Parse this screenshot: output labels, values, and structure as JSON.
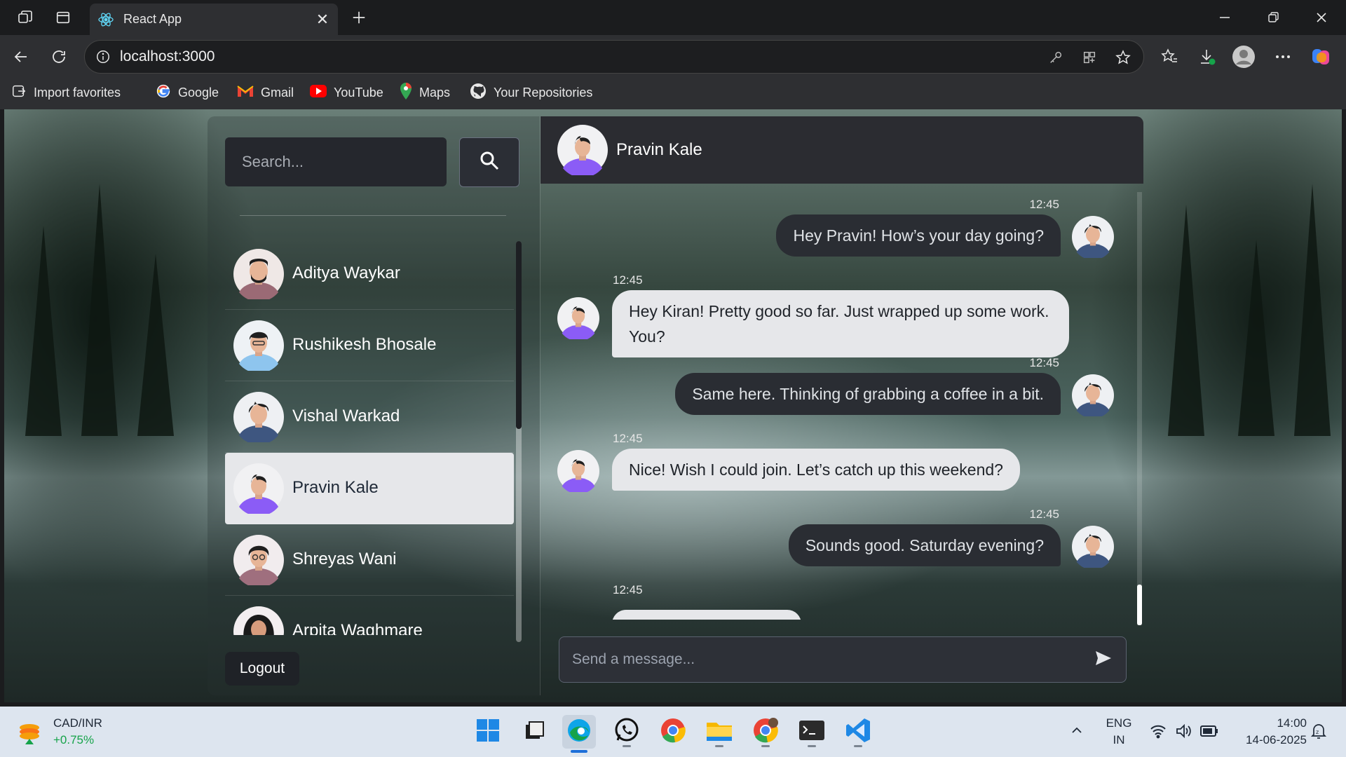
{
  "browser": {
    "tab_title": "React App",
    "tab_close": "✕",
    "url": "localhost:3000",
    "bookmarks": [
      {
        "label": "Import favorites"
      },
      {
        "label": "Google"
      },
      {
        "label": "Gmail"
      },
      {
        "label": "YouTube"
      },
      {
        "label": "Maps"
      },
      {
        "label": "Your Repositories"
      }
    ]
  },
  "sidebar": {
    "search_placeholder": "Search...",
    "contacts": [
      {
        "name": "Aditya Waykar"
      },
      {
        "name": "Rushikesh Bhosale"
      },
      {
        "name": "Vishal Warkad"
      },
      {
        "name": "Pravin Kale",
        "active": true
      },
      {
        "name": "Shreyas Wani"
      },
      {
        "name": "Arpita Waghmare"
      }
    ],
    "logout_label": "Logout"
  },
  "chat": {
    "header_name": "Pravin Kale",
    "messages": [
      {
        "from": "me",
        "time": "12:45",
        "text": "Hey Pravin! How’s your day going?"
      },
      {
        "from": "them",
        "time": "12:45",
        "text": "Hey Kiran! Pretty good so far. Just wrapped up some work. You?"
      },
      {
        "from": "me",
        "time": "12:45",
        "text": "Same here. Thinking of grabbing a coffee in a bit."
      },
      {
        "from": "them",
        "time": "12:45",
        "text": "Nice! Wish I could join. Let’s catch up this weekend?"
      },
      {
        "from": "me",
        "time": "12:45",
        "text": "Sounds good. Saturday evening?"
      },
      {
        "from": "them",
        "time": "12:45",
        "text": ""
      }
    ],
    "composer_placeholder": "Send a message..."
  },
  "taskbar": {
    "widget_pair": "CAD/INR",
    "widget_change": "+0.75%",
    "language_line1": "ENG",
    "language_line2": "IN",
    "time": "14:00",
    "date": "14-06-2025"
  },
  "colors": {
    "accent_purple": "#8b5cf6",
    "bubble_sent": "#2a2d33",
    "bubble_received": "#e6e7ea",
    "positive_change": "#16a34a"
  }
}
